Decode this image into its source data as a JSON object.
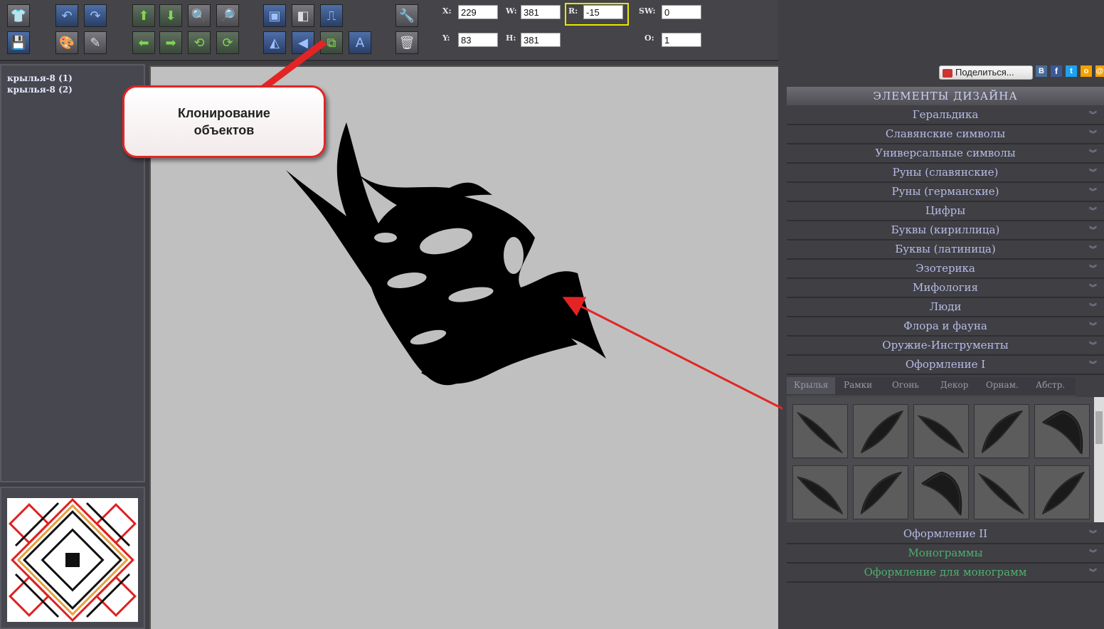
{
  "toolbar": {
    "fields": {
      "x": {
        "label": "X:",
        "value": "229"
      },
      "y": {
        "label": "Y:",
        "value": "83"
      },
      "w": {
        "label": "W:",
        "value": "381"
      },
      "h": {
        "label": "H:",
        "value": "381"
      },
      "r": {
        "label": "R:",
        "value": "-15"
      },
      "sw": {
        "label": "SW:",
        "value": "0"
      },
      "o": {
        "label": "O:",
        "value": "1"
      }
    }
  },
  "layers": {
    "items": [
      {
        "label": "крылья-8 (1)"
      },
      {
        "label": "крылья-8 (2)"
      }
    ]
  },
  "callout": {
    "line1": "Клонирование",
    "line2": "объектов"
  },
  "share": {
    "label": "Поделиться..."
  },
  "design": {
    "title": "ЭЛЕМЕНТЫ ДИЗАЙНА",
    "sections": [
      "Геральдика",
      "Славянские символы",
      "Универсальные символы",
      "Руны (славянские)",
      "Руны (германские)",
      "Цифры",
      "Буквы (кириллица)",
      "Буквы (латиница)",
      "Эзотерика",
      "Мифология",
      "Люди",
      "Флора и фауна",
      "Оружие-Инструменты",
      "Оформление I"
    ],
    "subtabs": [
      "Крылья",
      "Рамки",
      "Огонь",
      "Декор",
      "Орнам.",
      "Абстр."
    ],
    "bottom_sections": [
      "Оформление II",
      "Монограммы",
      "Оформление для монограмм"
    ]
  },
  "colors": {
    "accent_red": "#e42424",
    "highlight_yellow": "#e8e800",
    "canvas_bg": "#c0c0c0"
  }
}
